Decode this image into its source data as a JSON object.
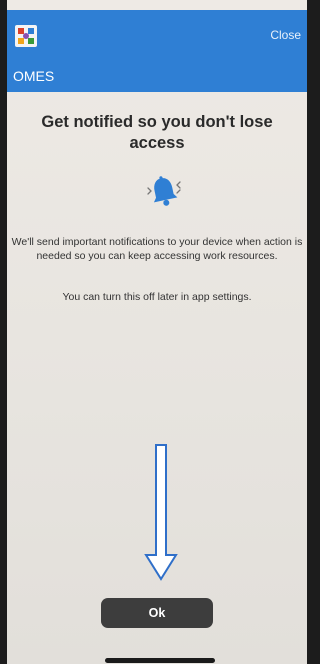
{
  "header": {
    "app_name": "OMES",
    "close_label": "Close",
    "logo_icon": "app-logo-icon",
    "background_color": "#2f7fd4"
  },
  "content": {
    "title": "Get notified so you don't lose access",
    "icon": "bell-icon",
    "icon_color": "#2f7fd4",
    "message": "We'll send important notifications to your device when action is needed so you can keep accessing work resources.",
    "secondary_message": "You can turn this off later in app settings."
  },
  "annotation": {
    "icon": "arrow-down-icon"
  },
  "footer": {
    "ok_label": "Ok"
  }
}
